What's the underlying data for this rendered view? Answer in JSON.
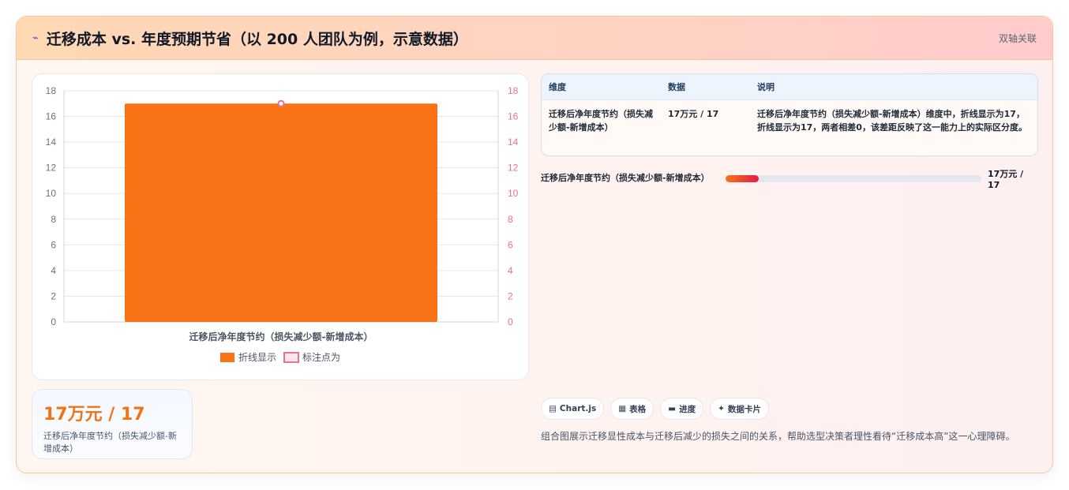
{
  "header": {
    "icon": "sparkle-icon",
    "title": "迁移成本 vs. 年度预期节省（以 200 人团队为例，示意数据）",
    "tag": "双轴关联"
  },
  "chart_data": {
    "type": "bar",
    "categories": [
      "迁移后净年度节约（损失减少额-新增成本）"
    ],
    "series": [
      {
        "name": "折线显示",
        "type": "bar",
        "axis": "left",
        "values": [
          17
        ],
        "color": "#f97316"
      },
      {
        "name": "标注点为",
        "type": "line",
        "axis": "right",
        "values": [
          17
        ],
        "color": "#e8728f"
      }
    ],
    "left_ticks": [
      "0",
      "2",
      "4",
      "6",
      "8",
      "10",
      "12",
      "14",
      "16",
      "18"
    ],
    "right_ticks": [
      "0",
      "2",
      "4",
      "6",
      "8",
      "10",
      "12",
      "14",
      "16",
      "18"
    ],
    "ylim": [
      0,
      18
    ],
    "y2lim": [
      0,
      18
    ],
    "grid": true,
    "legend": "bottom"
  },
  "stat": {
    "value": "17万元 / 17",
    "label": "迁移后净年度节约（损失减少额-新增成本）"
  },
  "table": {
    "headers": [
      "维度",
      "数据",
      "说明"
    ],
    "rows": [
      [
        "迁移后净年度节约（损失减少额-新增成本）",
        "17万元 / 17",
        "迁移后净年度节约（损失减少额-新增成本）维度中，折线显示为17，折线显示为17，两者相差0，该差距反映了这一能力上的实际区分度。"
      ]
    ]
  },
  "progress": {
    "label": "迁移后净年度节约（损失减少额-新增成本）",
    "value_text": "17万元 / 17",
    "fraction": 0.13
  },
  "chips": [
    {
      "icon": "chart-icon",
      "glyph": "▤",
      "label": "Chart.js"
    },
    {
      "icon": "table-icon",
      "glyph": "▦",
      "label": "表格"
    },
    {
      "icon": "progress-icon",
      "glyph": "▬",
      "label": "进度"
    },
    {
      "icon": "card-icon",
      "glyph": "✦",
      "label": "数据卡片"
    }
  ],
  "description": "组合图展示迁移显性成本与迁移后减少的损失之间的关系，帮助选型决策者理性看待“迁移成本高”这一心理障碍。"
}
